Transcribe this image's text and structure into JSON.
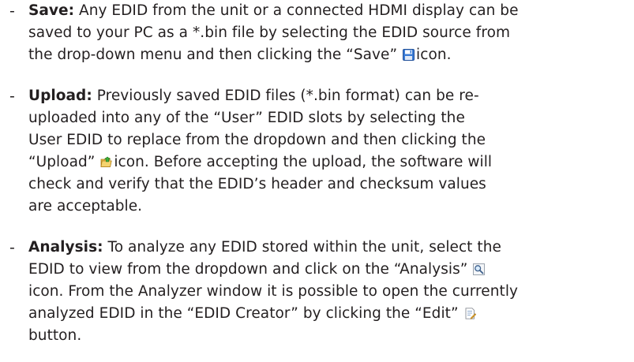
{
  "bullets": {
    "dash": "-",
    "save": {
      "label": "Save:",
      "line1": " Any EDID from the unit or a connected HDMI display can be",
      "line2": "saved to your PC as a *.bin file by selecting the EDID source from",
      "line3_a": "the drop-down menu and then clicking the “Save”",
      "line3_b": "icon.",
      "icon": "save-floppy-icon"
    },
    "upload": {
      "label": "Upload:",
      "line1": " Previously saved EDID files (*.bin format) can be re-",
      "line2": "uploaded into any of the “User” EDID slots by selecting the",
      "line3": "User EDID to replace from the dropdown and then clicking the",
      "line4_a": "“Upload”",
      "line4_b": "icon. Before accepting the upload, the software will",
      "line5": "check and verify that the EDID’s header and checksum values",
      "line6": "are acceptable.",
      "icon": "upload-folder-icon"
    },
    "analysis": {
      "label": "Analysis:",
      "line1": " To analyze any EDID stored within the unit, select the",
      "line2_a": "EDID to view from the dropdown and click on the “Analysis”",
      "line3": "icon. From the Analyzer window it is possible to open the currently",
      "line4": "analyzed EDID in the “EDID Creator” by clicking the “Edit”",
      "line5": "button.",
      "icon_analysis": "magnifier-icon",
      "icon_edit": "edit-document-icon"
    }
  }
}
